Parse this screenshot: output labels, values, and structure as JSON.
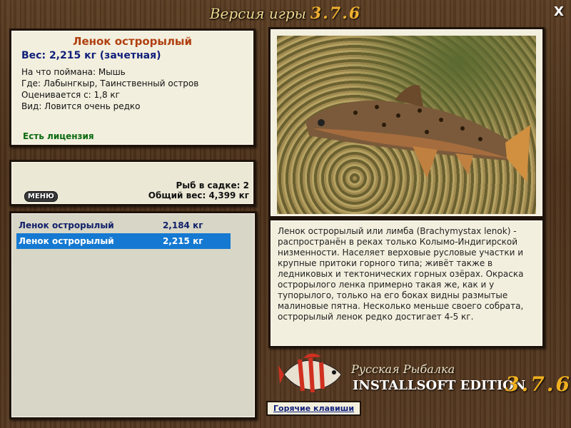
{
  "window": {
    "title_prefix": "Версия игры",
    "title_version": "3.7.6",
    "close_label": "X"
  },
  "info": {
    "fish_name": "Ленок острорылый",
    "weight": "Вес: 2,215 кг (зачетная)",
    "lines": [
      "На что поймана: Мышь",
      "Где: Лабынгкыр, Таинственный остров",
      "Оценивается с: 1,8 кг",
      "Вид: Ловится очень редко"
    ],
    "license": "Есть лицензия"
  },
  "summary": {
    "menu_label": "МЕНЮ",
    "fish_count": "Рыб в садке: 2",
    "total_weight": "Общий вес: 4,399 кг"
  },
  "catch_list": [
    {
      "name": "Ленок острорылый",
      "weight": "2,184 кг",
      "selected": false
    },
    {
      "name": "Ленок острорылый",
      "weight": "2,215 кг",
      "selected": true
    }
  ],
  "description": "Ленок острорылый или лимба (Brachymystax lenok) - распространён в реках только Колымо-Индигирской низменности. Населяет верховые русловые участки и крупные притоки горного типа; живёт также в ледниковых и тектонических горных озёрах. Окраска острорылого ленка примерно такая же, как и у тупорылого, только на его боках видны размытые малиновые пятна. Несколько меньше своего собрата, острорылый ленок редко достигает 4-5 кг.",
  "logo": {
    "line1": "Русская Рыбалка",
    "line2": "INSTALLSOFT EDITION",
    "version": "3.7.6"
  },
  "hotkeys_label": "Горячие клавиши",
  "colors": {
    "selected_row": "#1579d2",
    "fish_name": "#b04010",
    "license": "#0a6a10",
    "version_gold": "#f0b030"
  }
}
